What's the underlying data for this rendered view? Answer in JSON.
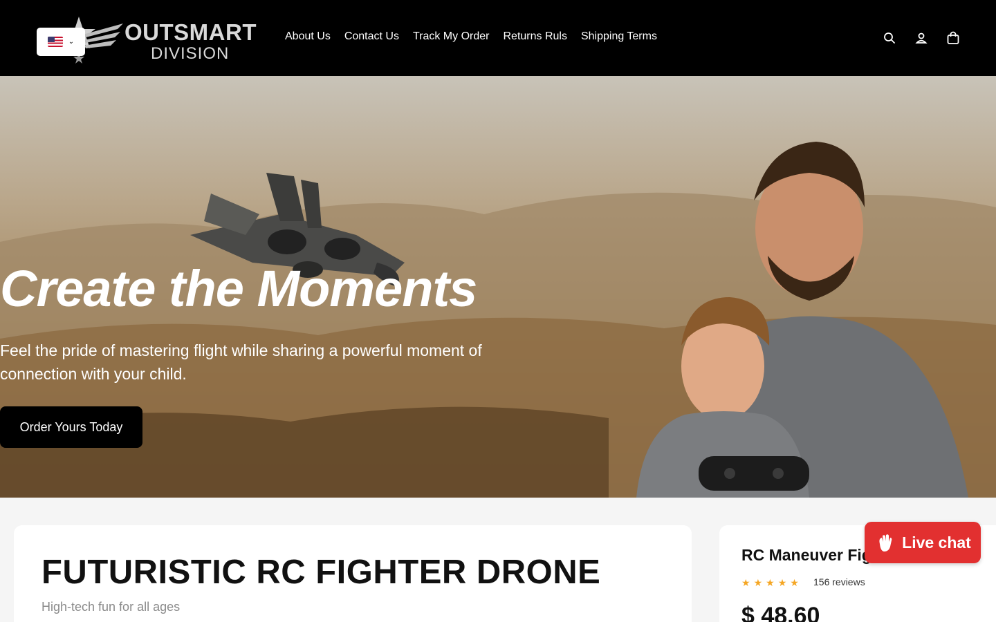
{
  "brand": {
    "line1": "OUTSMART",
    "line2": "DIVISION"
  },
  "language": {
    "selected_flag": "us-flag-icon"
  },
  "nav": {
    "items": [
      {
        "label": "About Us"
      },
      {
        "label": "Contact Us"
      },
      {
        "label": "Track My Order"
      },
      {
        "label": "Returns Ruls"
      },
      {
        "label": "Shipping Terms"
      }
    ]
  },
  "header_icons": [
    "search-icon",
    "account-icon",
    "cart-icon"
  ],
  "hero": {
    "title": "Create the Moments",
    "subtitle": "Feel the pride of mastering flight while sharing a powerful moment of connection with your child.",
    "cta_label": "Order Yours Today"
  },
  "feature": {
    "title": "FUTURISTIC RC FIGHTER DRONE",
    "subtitle": "High-tech fun for all ages"
  },
  "product": {
    "name": "RC Maneuver Fig",
    "rating": 5,
    "reviews": "156 reviews",
    "price": "$ 48.60"
  },
  "live_chat": {
    "label": "Live chat"
  },
  "colors": {
    "header_bg": "#000000",
    "live_chat": "#e23030",
    "star": "#f5a623"
  }
}
